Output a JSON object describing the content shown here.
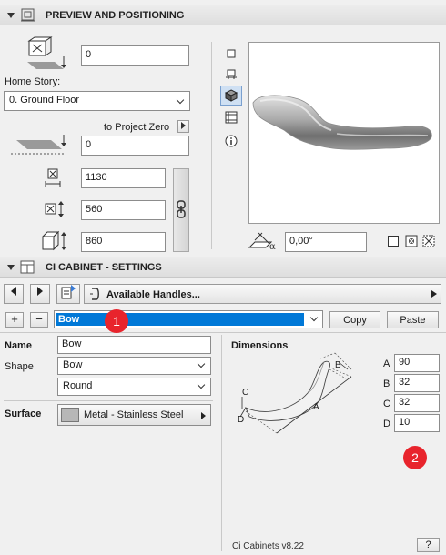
{
  "preview_section": {
    "title": "PREVIEW AND POSITIONING",
    "elevation_value": "0",
    "home_story_label": "Home Story:",
    "home_story_value": "0. Ground Floor",
    "to_project_zero_label": "to Project Zero",
    "project_zero_value": "0",
    "width_value": "1130",
    "depth_value": "560",
    "height_value": "860",
    "angle_value": "0,00°",
    "view_icons": [
      "floor-plan-icon",
      "section-icon",
      "3d-view-icon",
      "list-icon",
      "info-icon"
    ]
  },
  "settings_section": {
    "title": "CI CABINET - SETTINGS",
    "nav_label": "Available Handles...",
    "selector_value": "Bow",
    "copy_label": "Copy",
    "paste_label": "Paste",
    "name_label": "Name",
    "name_value": "Bow",
    "shape_label": "Shape",
    "shape_value_1": "Bow",
    "shape_value_2": "Round",
    "surface_label": "Surface",
    "surface_value": "Metal - Stainless Steel",
    "surface_swatch_color": "#b7b7b7",
    "dimensions_title": "Dimensions",
    "dimensions": [
      {
        "label": "A",
        "value": "90"
      },
      {
        "label": "B",
        "value": "32"
      },
      {
        "label": "C",
        "value": "32"
      },
      {
        "label": "D",
        "value": "10"
      }
    ],
    "diagram_labels": {
      "a": "A",
      "b": "B",
      "c": "C",
      "d": "D"
    },
    "footer_version": "Ci Cabinets v8.22",
    "help_label": "?"
  },
  "annotations": {
    "badge_1": "1",
    "badge_2": "2",
    "badge_color": "#e8242c"
  }
}
